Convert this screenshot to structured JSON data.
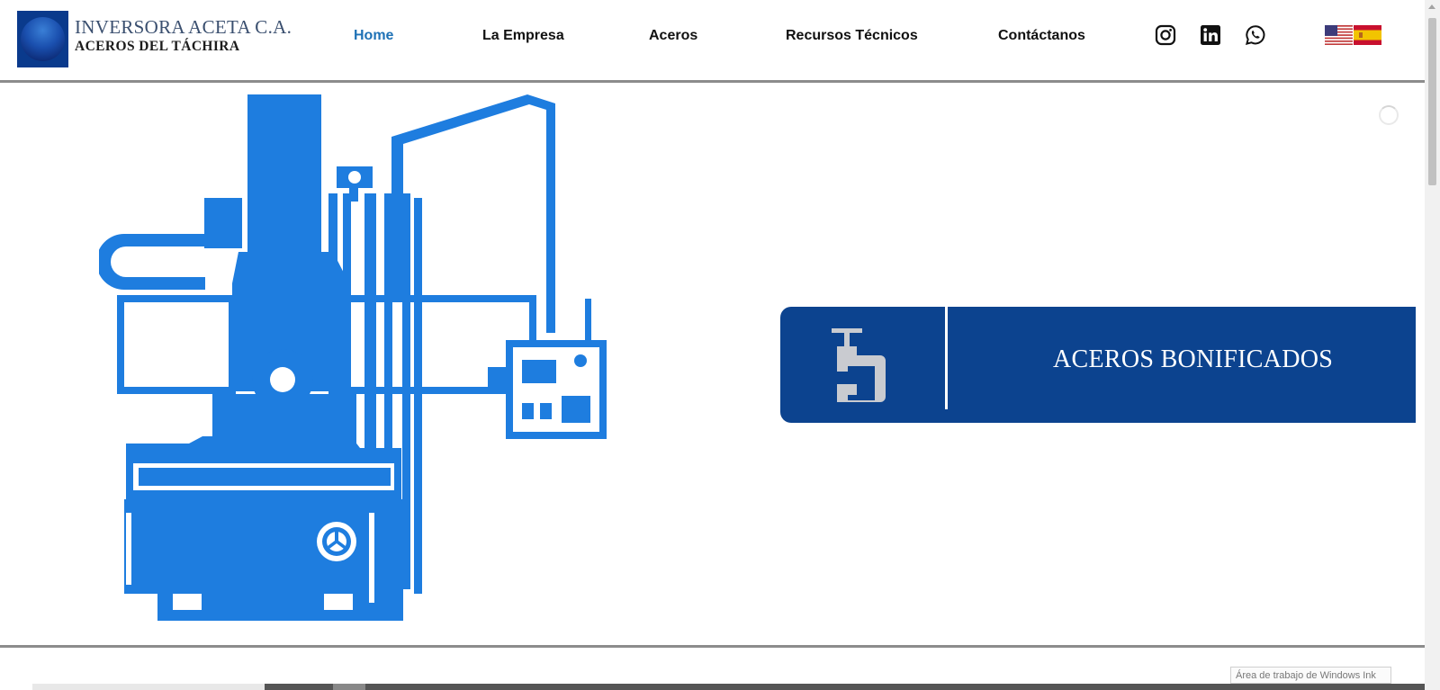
{
  "brand": {
    "name": "INVERSORA ACETA C.A.",
    "subtitle": "ACEROS DEL TÁCHIRA"
  },
  "nav": {
    "items": [
      {
        "label": "Home",
        "active": true
      },
      {
        "label": "La Empresa",
        "active": false
      },
      {
        "label": "Aceros",
        "active": false
      },
      {
        "label": "Recursos Técnicos",
        "active": false
      },
      {
        "label": "Contáctanos",
        "active": false
      }
    ]
  },
  "social": [
    "instagram-icon",
    "linkedin-icon",
    "whatsapp-icon"
  ],
  "languages": [
    "English (US flag)",
    "Español (Spain flag)"
  ],
  "hero": {
    "banner_title": "ACEROS BONIFICADOS",
    "banner_icon": "clamp-icon",
    "illustration": "vertical-lathe-machine"
  },
  "colors": {
    "accent_nav": "#1f72b6",
    "machine_blue": "#1e7ddf",
    "banner_blue": "#0c438f",
    "divider_gray": "#8c8c8c"
  },
  "system": {
    "windows_ink": "Área de trabajo de Windows Ink"
  }
}
